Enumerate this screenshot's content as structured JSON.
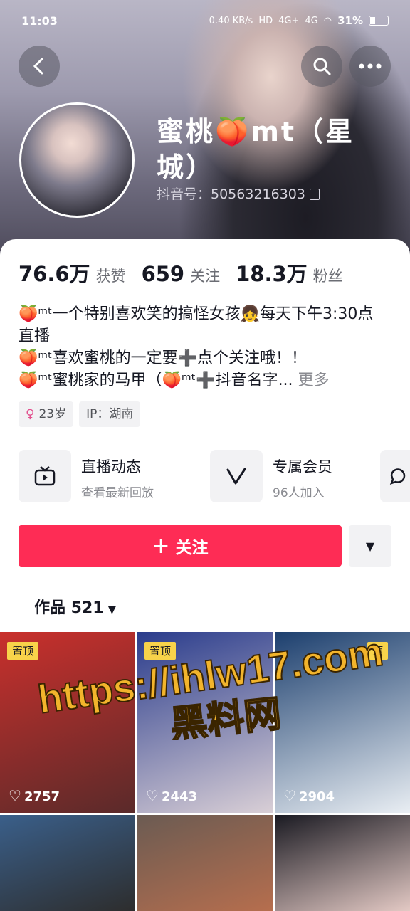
{
  "status_bar": {
    "time": "11:03",
    "speed": "0.40 KB/s",
    "hd": "HD",
    "net1": "4G+",
    "net2": "4G",
    "battery": "31%"
  },
  "profile": {
    "name": "蜜桃🍑mt（星城）",
    "douyin_id": "抖音号：50563216303"
  },
  "stats": [
    {
      "num": "76.6万",
      "label": "获赞"
    },
    {
      "num": "659",
      "label": "关注"
    },
    {
      "num": "18.3万",
      "label": "粉丝"
    }
  ],
  "bio": {
    "line1": "🍑ᵐᵗ一个特别喜欢笑的搞怪女孩👧每天下午3:30点直播",
    "line2": "🍑ᵐᵗ喜欢蜜桃的一定要➕点个关注哦！！",
    "line3": "🍑ᵐᵗ蜜桃家的马甲（🍑ᵐᵗ➕抖音名字...",
    "more": "更多"
  },
  "tags": {
    "age": "23岁",
    "ip": "IP：湖南"
  },
  "features": [
    {
      "title": "直播动态",
      "sub": "查看最新回放"
    },
    {
      "title": "专属会员",
      "sub": "96人加入"
    }
  ],
  "follow_label": "关注",
  "works_tab": "作品 521",
  "videos": [
    {
      "pinned": "置顶",
      "likes": "2757",
      "c1": "#c9302c",
      "c2": "#5a2a2a"
    },
    {
      "pinned": "置顶",
      "likes": "2443",
      "c1": "#2a3c8c",
      "c2": "#d9cfd6"
    },
    {
      "pinned": "顶",
      "likes": "2904",
      "c1": "#1c3f6e",
      "c2": "#e9eef3"
    },
    {
      "pinned": "",
      "likes": "",
      "c1": "#3a5f8a",
      "c2": "#2d2d2d"
    },
    {
      "pinned": "",
      "likes": "",
      "c1": "#6b5b52",
      "c2": "#b66e4e"
    },
    {
      "pinned": "",
      "likes": "",
      "c1": "#1a1a22",
      "c2": "#e3c9c4"
    }
  ],
  "watermark": {
    "url": "https://ihlw17.com",
    "site": "黑料网"
  }
}
